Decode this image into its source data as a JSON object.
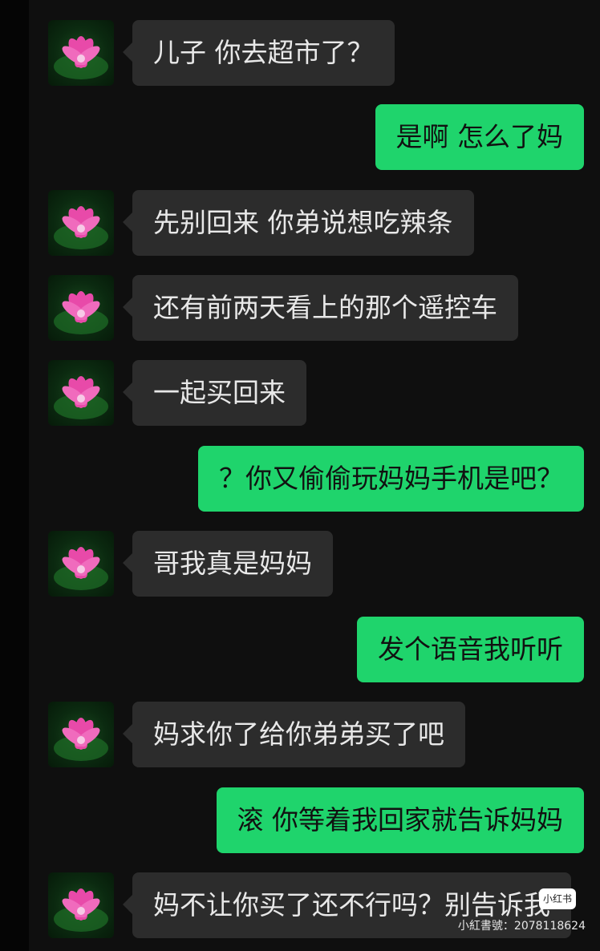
{
  "messages": [
    {
      "side": "in",
      "text": "儿子 你去超市了？",
      "avatar": "lotus-avatar"
    },
    {
      "side": "out",
      "text": "是啊 怎么了妈"
    },
    {
      "side": "in",
      "text": "先别回来 你弟说想吃辣条",
      "avatar": "lotus-avatar"
    },
    {
      "side": "in",
      "text": "还有前两天看上的那个遥控车",
      "avatar": "lotus-avatar"
    },
    {
      "side": "in",
      "text": "一起买回来",
      "avatar": "lotus-avatar"
    },
    {
      "side": "out",
      "text": "？你又偷偷玩妈妈手机是吧？"
    },
    {
      "side": "in",
      "text": "哥我真是妈妈",
      "avatar": "lotus-avatar"
    },
    {
      "side": "out",
      "text": "发个语音我听听"
    },
    {
      "side": "in",
      "text": "妈求你了给你弟弟买了吧",
      "avatar": "lotus-avatar"
    },
    {
      "side": "out",
      "text": "滚 你等着我回家就告诉妈妈"
    },
    {
      "side": "in",
      "text": "妈不让你买了还不行吗？别告诉我",
      "avatar": "lotus-avatar"
    }
  ],
  "watermark": {
    "logo_text": "小红书",
    "id_text": "小紅書號：2078118624"
  },
  "colors": {
    "incoming_bubble": "#2c2c2c",
    "outgoing_bubble": "#1fd46c",
    "background": "#0f0f0f"
  }
}
